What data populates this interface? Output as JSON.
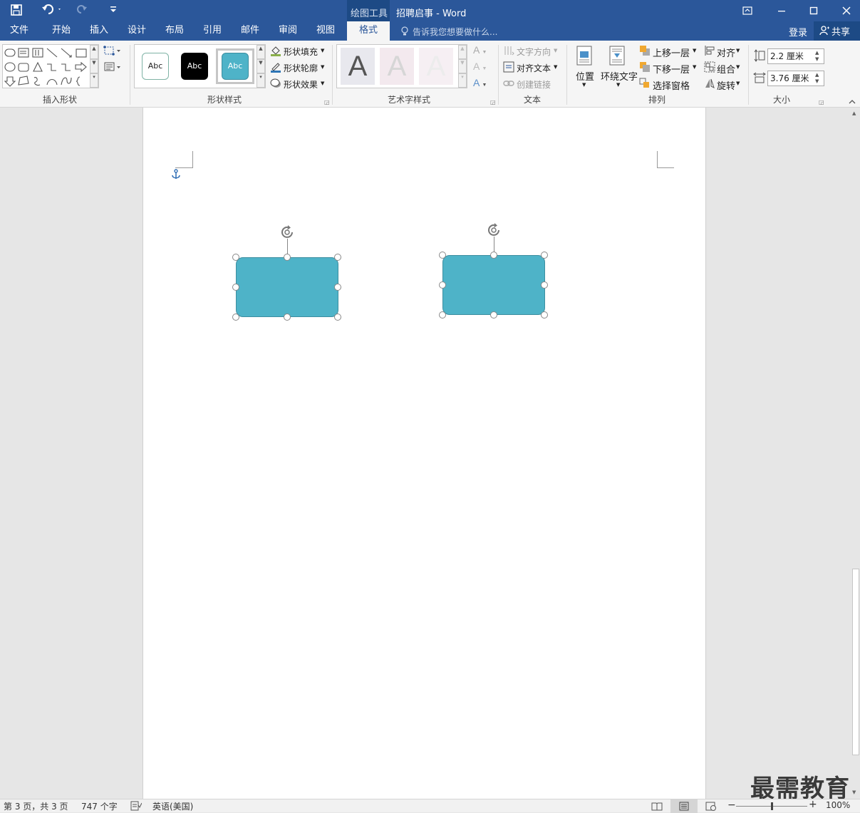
{
  "title_bar": {
    "context_tool": "绘图工具",
    "doc_title": "招聘启事 - Word",
    "save_icon": "save-icon",
    "customize_icon": "customize-toolbar-icon"
  },
  "tabs": [
    "文件",
    "开始",
    "插入",
    "设计",
    "布局",
    "引用",
    "邮件",
    "审阅",
    "视图",
    "格式"
  ],
  "active_tab": "格式",
  "tell_me": "告诉我您想要做什么...",
  "login": "登录",
  "share": "共享",
  "ribbon": {
    "insert_shapes": {
      "label": "插入形状"
    },
    "shape_styles": {
      "label": "形状样式",
      "thumb_text": "Abc",
      "fill": "形状填充",
      "outline": "形状轮廓",
      "effects": "形状效果"
    },
    "wordart": {
      "label": "艺术字样式",
      "letter": "A"
    },
    "text": {
      "label": "文本",
      "direction": "文字方向",
      "align": "对齐文本",
      "link": "创建链接"
    },
    "arrange": {
      "label": "排列",
      "position": "位置",
      "wrap": "环绕文字",
      "bring_forward": "上移一层",
      "send_backward": "下移一层",
      "selection_pane": "选择窗格",
      "align": "对齐",
      "group": "组合",
      "rotate": "旋转"
    },
    "size": {
      "label": "大小",
      "height": "2.2 厘米",
      "width": "3.76 厘米"
    }
  },
  "status": {
    "page": "第 3 页，共 3 页",
    "words": "747 个字",
    "language": "英语(美国)",
    "zoom": "100%",
    "zoom_level": 1.0
  },
  "watermark": "最需教育",
  "colors": {
    "brand": "#2b579a",
    "shape_fill": "#4eb3c8"
  }
}
